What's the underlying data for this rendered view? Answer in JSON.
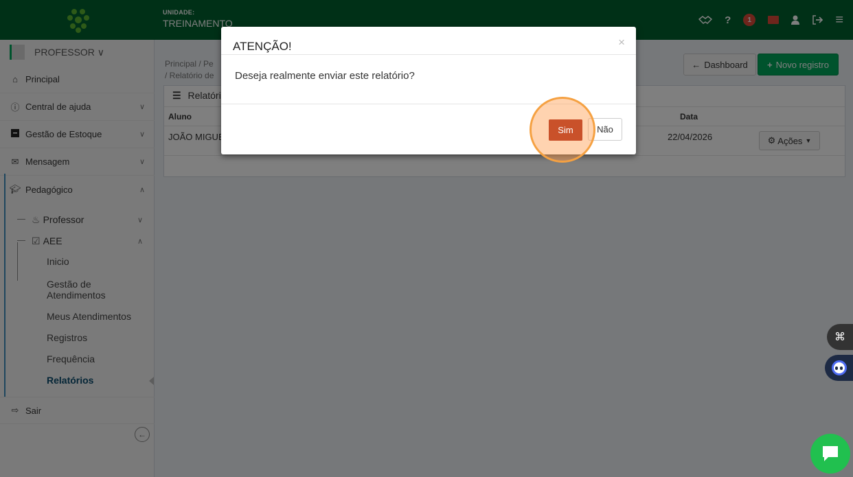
{
  "header": {
    "unit_label": "UNIDADE:",
    "unit_value": "TREINAMENTO",
    "notification_count": "1",
    "icons": [
      "handshake-icon",
      "help-icon",
      "notification-icon",
      "mail-icon",
      "user-icon",
      "logout-icon",
      "menu-icon"
    ]
  },
  "sidebar": {
    "user": "PROFESSOR ∨",
    "items": [
      {
        "label": "Principal",
        "icon": "home-icon"
      },
      {
        "label": "Central de ajuda",
        "icon": "info-icon"
      },
      {
        "label": "Gestão de Estoque",
        "icon": "box-icon"
      },
      {
        "label": "Mensagem",
        "icon": "envelope-icon"
      },
      {
        "label": "Pedagógico",
        "icon": "graduation-icon"
      },
      {
        "label": "Sair",
        "icon": "exit-icon"
      }
    ],
    "sub": [
      {
        "label": "Professor",
        "icon": "teacher-icon"
      },
      {
        "label": "AEE",
        "icon": "checklist-icon"
      }
    ],
    "aee_items": [
      "Inicio",
      "Gestão de\nAtendimentos",
      "Meus Atendimentos",
      "Registros",
      "Frequência",
      "Relatórios"
    ]
  },
  "main": {
    "breadcrumb_line1": "Principal  /  Pe",
    "breadcrumb_line2": "/  Relatório de",
    "dashboard_button": "Dashboard",
    "new_button": "Novo registro",
    "box_title": "Relatóri",
    "columns": {
      "aluno": "Aluno",
      "data": "Data"
    },
    "row": {
      "aluno": "JOÃO MIGUE",
      "data": "22/04/2026",
      "acoes": "Ações"
    }
  },
  "modal": {
    "title": "ATENÇÃO!",
    "close": "×",
    "message": "Deseja realmente enviar este relatório?",
    "yes": "Sim",
    "no": "Não"
  },
  "colors": {
    "topbar": "#00612e",
    "accent_green": "#00a65a",
    "danger": "#c9512a",
    "highlight": "#f5a142"
  }
}
